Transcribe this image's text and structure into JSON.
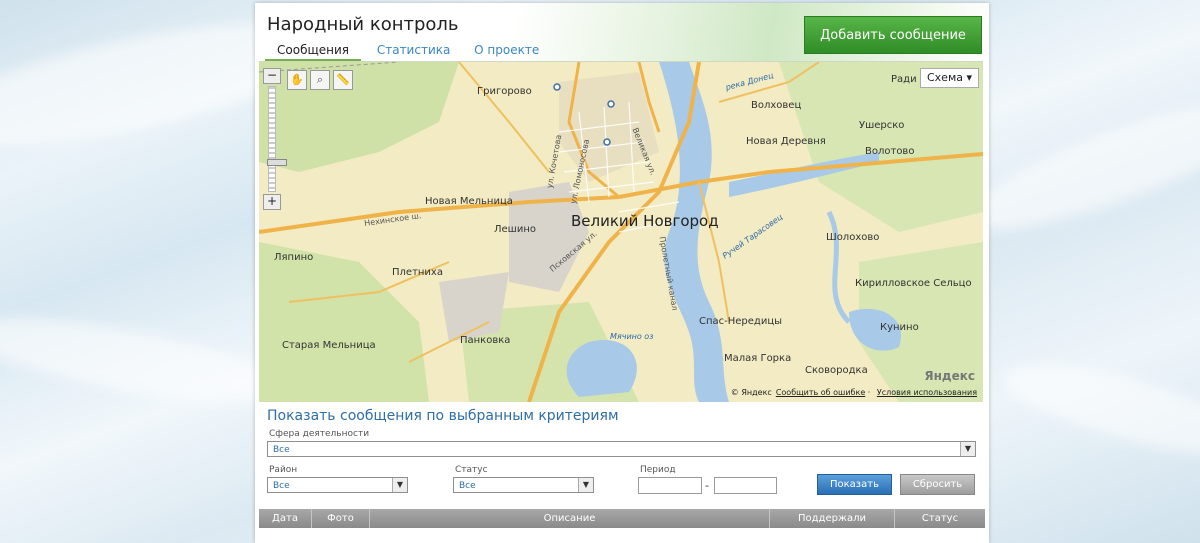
{
  "header": {
    "site_title": "Народный контроль",
    "tabs": [
      {
        "label": "Сообщения"
      },
      {
        "label": "Статистика"
      },
      {
        "label": "О проекте"
      }
    ],
    "add_button": "Добавить сообщение"
  },
  "map": {
    "scheme_label": "Схема ▾",
    "city_label": "Великий Новгород",
    "places": [
      "Григорово",
      "Волховец",
      "Новая Деревня",
      "Ушерско",
      "Волотово",
      "Новая Мельница",
      "Лешино",
      "Ляпино",
      "Плетниха",
      "Шолохово",
      "Кирилловское Сельцо",
      "Кунино",
      "Спас-Нередицы",
      "Малая Горка",
      "Сковородка",
      "Старая Мельница",
      "Панковка",
      "Ради"
    ],
    "streets": [
      "ул. Кочетова",
      "ул. Ломоносова",
      "Великая ул.",
      "Нехинское ш.",
      "Псковская ул.",
      "Ручей Тарасовец",
      "река Донец",
      "Мячино оз",
      "Пролетный канал"
    ],
    "logo": "Яндекс",
    "footer_copyright": "© Яндекс",
    "footer_report": "Сообщить об ошибке",
    "footer_terms": "Условия использования"
  },
  "filters": {
    "title": "Показать сообщения по выбранным критериям",
    "sphere_label": "Сфера деятельности",
    "sphere_value": "Все",
    "district_label": "Район",
    "district_value": "Все",
    "status_label": "Статус",
    "status_value": "Все",
    "period_label": "Период",
    "period_dash": "-",
    "show_button": "Показать",
    "reset_button": "Сбросить"
  },
  "table": {
    "columns": [
      "Дата",
      "Фото",
      "Описание",
      "Поддержали",
      "Статус"
    ]
  },
  "colors": {
    "accent_green": "#3a9a30",
    "link_blue": "#3a86c5",
    "title_blue": "#2e6ea6"
  }
}
